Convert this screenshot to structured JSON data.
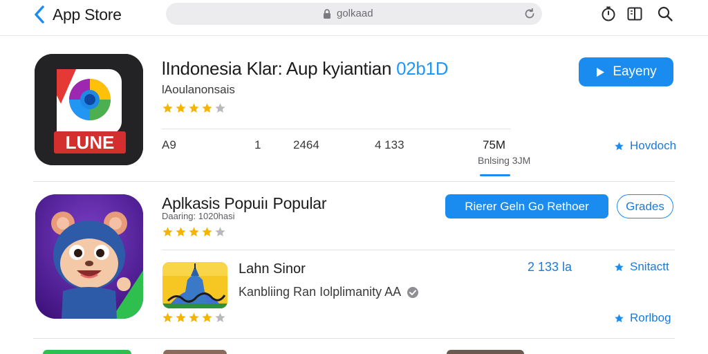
{
  "header": {
    "back_label": "App Store",
    "url": "golkaad"
  },
  "featured_app": {
    "title": "lIndonesia Klar: Aup kyiantian",
    "title_accent": "02b1D",
    "developer": "lAoulanonsais",
    "rating_stars": 4,
    "primary_button": "Eayeny",
    "stats": [
      "A9",
      "1",
      "2464",
      "4 133"
    ],
    "size_value": "75M",
    "size_label": "Bnlsing 3JM",
    "link": "Hovdoch"
  },
  "popular_section": {
    "title": "Aplkasis Popuiı Popular",
    "subtitle": "Daaring: 1020hasi",
    "rating_stars": 4,
    "primary_button": "Rierer Geln Go Rethoer",
    "secondary_button": "Grades"
  },
  "sub_app": {
    "title": "Lahn Sinor",
    "description": "Kanbliing Ran Iolplimanity AA",
    "rating_stars": 4,
    "count": "2 133 la",
    "link_top": "Snitactt",
    "link_bottom": "Rorlbog"
  },
  "colors": {
    "accent": "#1a8cf0",
    "star": "#f5b400",
    "star_empty": "#b9b9bd"
  }
}
